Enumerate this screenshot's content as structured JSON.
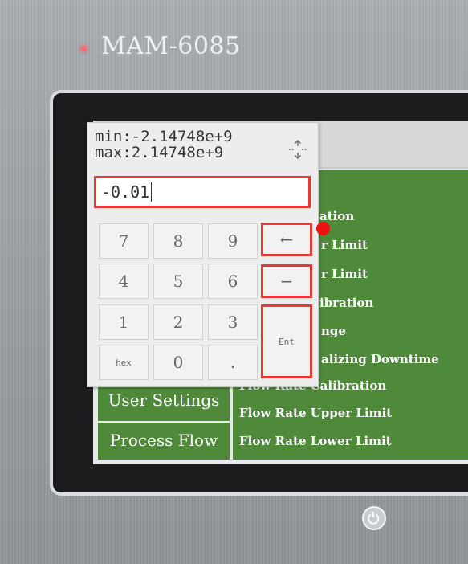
{
  "device": {
    "model": "MAM-6085"
  },
  "keypad": {
    "min_label": "min:-2.14748e+9",
    "max_label": "max:2.14748e+9",
    "entry_value": "-0.01",
    "keys": {
      "k7": "7",
      "k8": "8",
      "k9": "9",
      "k4": "4",
      "k5": "5",
      "k6": "6",
      "k1": "1",
      "k2": "2",
      "k3": "3",
      "hex": "hex",
      "k0": "0",
      "dot": ".",
      "backspace": "←",
      "minus": "−",
      "enter": "Ent"
    }
  },
  "sidebar": {
    "user_settings": "User Settings",
    "process_flow": "Process Flow"
  },
  "menu": {
    "item1": "ation",
    "item2": "r Limit",
    "item3": "r Limit",
    "item4": "ibration",
    "item5": "nge",
    "item6": "alizing Downtime",
    "item7": "Flow Rate Calibration",
    "item8": "Flow Rate Upper Limit",
    "item9": "Flow Rate Lower Limit"
  },
  "colors": {
    "green": "#4f8a3a",
    "highlight": "#e53935"
  }
}
